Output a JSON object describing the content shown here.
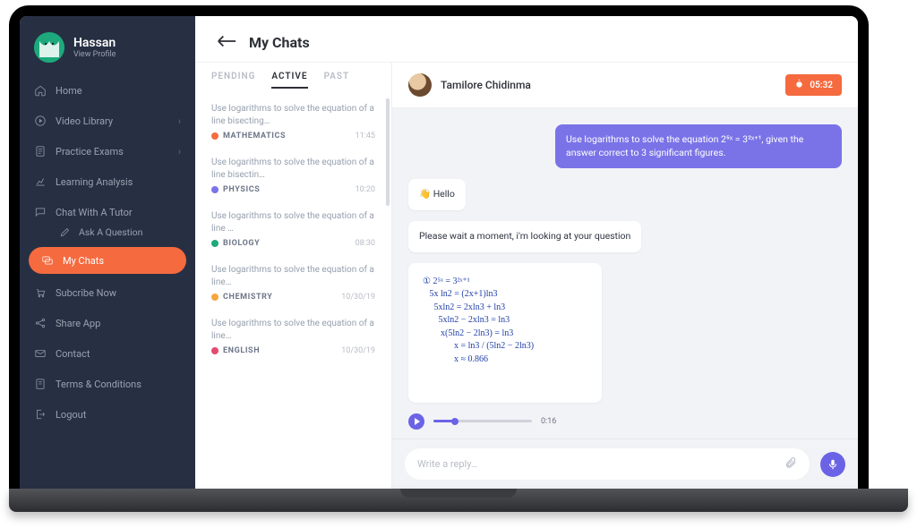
{
  "profile": {
    "name": "Hassan",
    "subtitle": "View Profile"
  },
  "sidebar": {
    "items": [
      {
        "label": "Home",
        "icon": "home-icon",
        "expandable": false
      },
      {
        "label": "Video Library",
        "icon": "play-icon",
        "expandable": true
      },
      {
        "label": "Practice  Exams",
        "icon": "doc-icon",
        "expandable": true
      },
      {
        "label": "Learning Analysis",
        "icon": "chart-icon",
        "expandable": false
      },
      {
        "label": "Chat With A Tutor",
        "icon": "chat-icon",
        "expandable": false
      },
      {
        "label": "My Chats",
        "icon": "chats-icon",
        "active": true
      },
      {
        "label": "Subcribe Now",
        "icon": "cart-icon",
        "expandable": false
      },
      {
        "label": "Share App",
        "icon": "share-icon",
        "expandable": false
      },
      {
        "label": "Contact",
        "icon": "mail-icon",
        "expandable": false
      },
      {
        "label": "Terms & Conditions",
        "icon": "terms-icon",
        "expandable": false
      },
      {
        "label": "Logout",
        "icon": "logout-icon",
        "expandable": false
      }
    ],
    "sub_ask": "Ask A Question"
  },
  "header": {
    "title": "My Chats"
  },
  "tabs": {
    "pending": "PENDING",
    "active": "ACTIVE",
    "past": "PAST",
    "selected": "active"
  },
  "chats": [
    {
      "preview": "Use logarithms to solve the equation of a line bisecting…",
      "subject": "MATHEMATICS",
      "color": "#f56a3f",
      "time": "11:45"
    },
    {
      "preview": "Use logarithms to solve the equation of a line bisectin…",
      "subject": "PHYSICS",
      "color": "#7a73e8",
      "time": "10:20"
    },
    {
      "preview": "Use logarithms to solve the equation of a line …",
      "subject": "BIOLOGY",
      "color": "#1ea97c",
      "time": "08:30"
    },
    {
      "preview": "Use logarithms to solve the equation of a line…",
      "subject": "CHEMISTRY",
      "color": "#f5a63f",
      "time": "10/30/19"
    },
    {
      "preview": "Use logarithms to solve the equation of a line…",
      "subject": "ENGLISH",
      "color": "#e34b6e",
      "time": "10/30/19"
    }
  ],
  "conversation": {
    "contact": "Tamilore Chidinma",
    "timer": "05:32",
    "messages": {
      "question": "Use logarithms to solve the equation   2⁵ˣ = 3²ˣ⁺¹, given the answer correct to 3 significant figures.",
      "hello": "Hello",
      "wait": "Please wait a moment, i'm looking at your question",
      "work": "① 2⁵ˣ = 3²ˣ⁺¹\n   5x ln2 = (2x+1)ln3\n     5xln2 = 2xln3 + ln3\n       5xln2 − 2xln3 = ln3\n        x(5ln2 − 2ln3) = ln3\n              x = ln3 / (5ln2 − 2ln3)\n              x ≈ 0.866",
      "audio_duration": "0:16"
    },
    "composer_placeholder": "Write a reply…"
  }
}
